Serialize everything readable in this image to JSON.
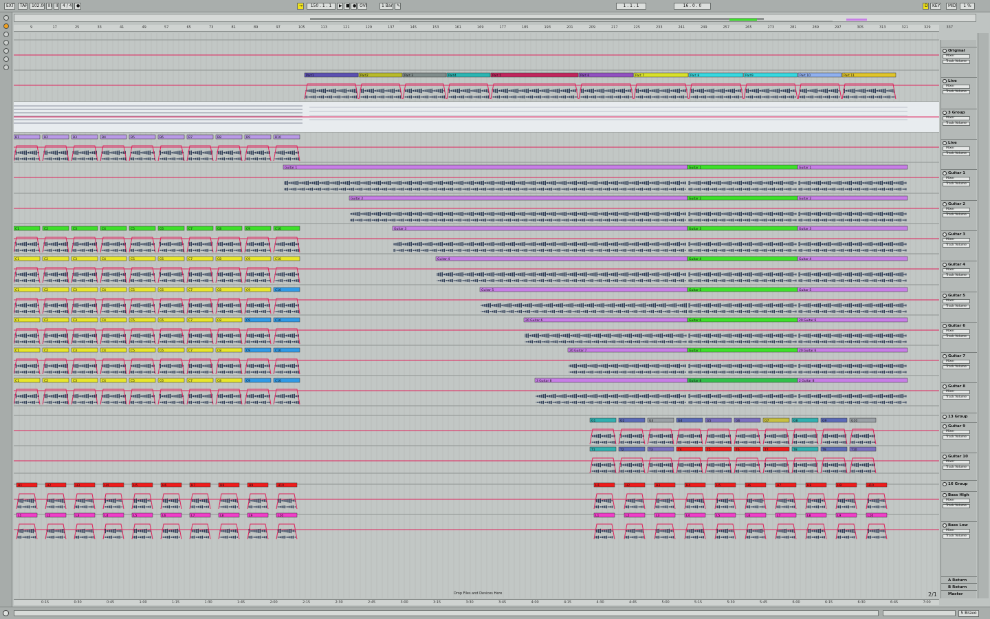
{
  "topbar": {
    "ext": "EXT",
    "tap": "TAP",
    "tempo": "102.00",
    "bars": "III",
    "loop": "III",
    "sig": "4 / 4",
    "metro": "●",
    "follow": "→",
    "pos": "150 .  1 .  1",
    "play": "▶",
    "stop": "■",
    "rec": "●",
    "ovr": "OVR",
    "quant": "1 Bar",
    "draw": "✎",
    "loop_start": "1 .  1 .  1",
    "loop_len": "16 .  0 .  0",
    "key": "KEY",
    "midi": "MIDI",
    "cpu": "1 %",
    "d_btn": "D"
  },
  "ruler_ticks": [
    "9",
    "17",
    "25",
    "33",
    "41",
    "49",
    "57",
    "65",
    "73",
    "81",
    "89",
    "97",
    "105",
    "113",
    "121",
    "129",
    "137",
    "145",
    "153",
    "161",
    "169",
    "177",
    "185",
    "193",
    "201",
    "209",
    "217",
    "225",
    "233",
    "241",
    "249",
    "257",
    "265",
    "273",
    "281",
    "289",
    "297",
    "305",
    "313",
    "321",
    "329",
    "337"
  ],
  "time_ticks": [
    "0:15",
    "0:30",
    "0:45",
    "1:00",
    "1:15",
    "1:30",
    "1:45",
    "2:00",
    "2:15",
    "2:30",
    "2:45",
    "3:00",
    "3:15",
    "3:30",
    "3:45",
    "4:00",
    "4:15",
    "4:30",
    "4:45",
    "5:00",
    "5:15",
    "5:30",
    "5:45",
    "6:00",
    "6:15",
    "6:30",
    "6:45",
    "7:00"
  ],
  "tracks": [
    {
      "name": "Original",
      "mixer": "Mixer",
      "param": "Track Volume"
    },
    {
      "name": "Live",
      "mixer": "Mixer",
      "param": "Track Volume"
    },
    {
      "name": "3 Group",
      "mixer": "Mixer",
      "param": "Track Volume"
    },
    {
      "name": "Live",
      "mixer": "Mixer",
      "param": "Track Volume"
    },
    {
      "name": "Guitar 1",
      "mixer": "Mixer",
      "param": "Track Volume"
    },
    {
      "name": "Guitar 2",
      "mixer": "Mixer",
      "param": "Track Volume"
    },
    {
      "name": "Guitar 3",
      "mixer": "Mixer",
      "param": "Track Volume"
    },
    {
      "name": "Guitar 4",
      "mixer": "Mixer",
      "param": "Track Volume"
    },
    {
      "name": "Guitar 5",
      "mixer": "Mixer",
      "param": "Track Volume"
    },
    {
      "name": "Guitar 6",
      "mixer": "Mixer",
      "param": "Track Volume"
    },
    {
      "name": "Guitar 7",
      "mixer": "Mixer",
      "param": "Track Volume"
    },
    {
      "name": "Guitar 8",
      "mixer": "Mixer",
      "param": "Track Volume"
    },
    {
      "name": "13 Group",
      "mixer": "",
      "param": ""
    },
    {
      "name": "Guitar 9",
      "mixer": "Mixer",
      "param": "Track Volume"
    },
    {
      "name": "Guitar 10",
      "mixer": "Mixer",
      "param": "Track Volume"
    },
    {
      "name": "16 Group",
      "mixer": "",
      "param": ""
    },
    {
      "name": "Bass High",
      "mixer": "Mixer",
      "param": "Track Volume"
    },
    {
      "name": "Bass Low",
      "mixer": "Mixer",
      "param": "Track Volume"
    }
  ],
  "returns": [
    "A Return",
    "B Return",
    "Master"
  ],
  "drop_text": "Drop Files and Devices Here",
  "pager": "2/1",
  "status_right": "5 Bravo",
  "colors": {
    "automation": "#e0205a",
    "purple": "#c77ee6",
    "green": "#3ee02a",
    "yellow": "#e8e62a",
    "red": "#ee1c1c",
    "pink": "#f03ec8",
    "blue": "#2f9ae8",
    "waveform": "#1d2d4a"
  },
  "live_clips": [
    "Part1",
    "Part2",
    "Part 3",
    "Part4",
    "Part 5",
    "Part 6",
    "Part 7",
    "Part 8",
    "Part9",
    "Part 10",
    "Part 11"
  ],
  "guitar_clips": [
    "Guitar 1",
    "Guitar 2",
    "Guitar 3",
    "Guitar 4",
    "Guitar 5",
    "20 Guitar 6",
    "20 Guitar 7",
    "3 Guitar 8"
  ],
  "guitar_clips_mid": [
    "Guitar 1",
    "Guitar 2",
    "Guitar 3",
    "Guitar 4",
    "Guitar 5",
    "Guitar 6",
    "Guitar 7",
    "Guitar 8"
  ],
  "guitar_clips_end": [
    "Guitar 1",
    "Guitar 2",
    "Guitar 3",
    "Guitar 4",
    "Guitar 5",
    "20 Guitar 6",
    "20 Guitar 6",
    "2 Guitar 8"
  ]
}
